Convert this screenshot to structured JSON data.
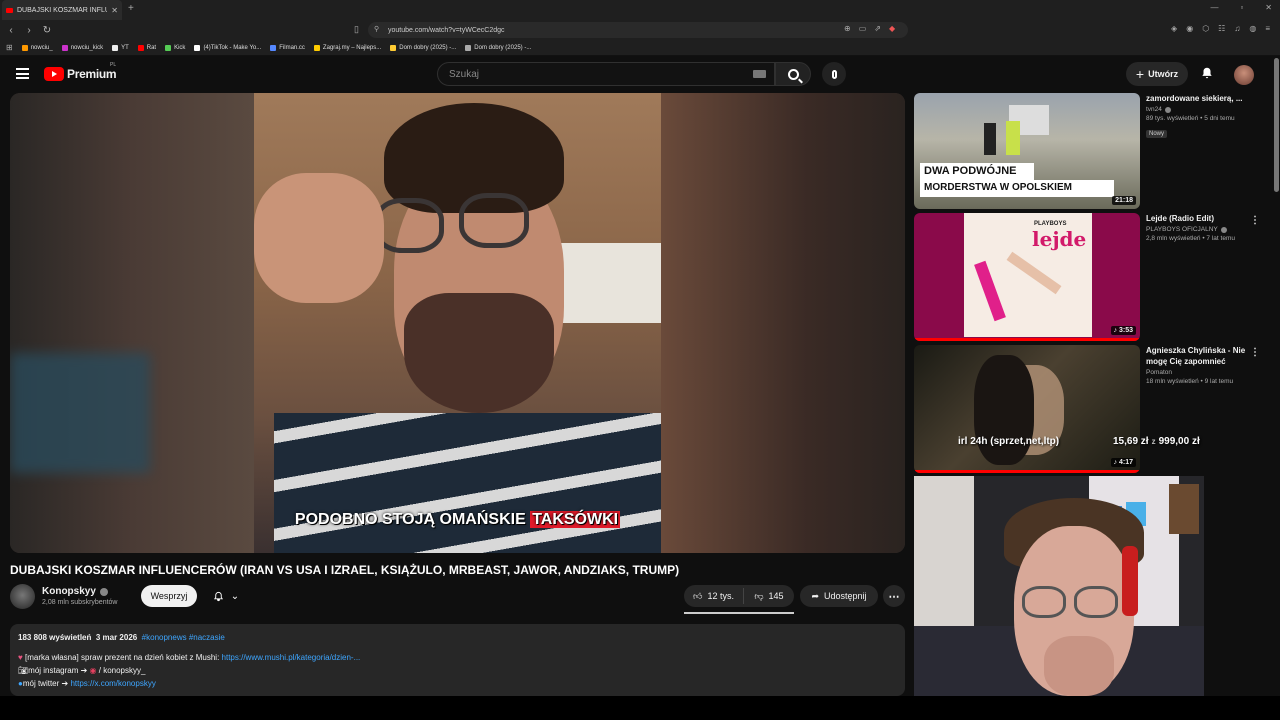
{
  "browser": {
    "tab_title": "DUBAJSKI KOSZMAR INFLUE",
    "url": "youtube.com/watch?v=tyWCecC2dgc",
    "bookmarks": [
      "nowciu_",
      "nowciu_kick",
      "YT",
      "Rat",
      "Kick",
      "(4)TikTok - Make Yo...",
      "Filman.cc",
      "Zagraj.my – Najleps...",
      "Dom dobry (2025) -...",
      "Dom dobry (2025) -..."
    ]
  },
  "header": {
    "logo": "Premium",
    "logo_region": "PL",
    "search_placeholder": "Szukaj",
    "create_label": "Utwórz"
  },
  "video": {
    "subtitle_main": "PODOBNO STOJĄ OMAŃSKIE",
    "subtitle_highlight": "TAKSÓWKI",
    "title": "DUBAJSKI KOSZMAR INFLUENCERÓW (IRAN VS USA I IZRAEL, KSIĄŻULO, MRBEAST, JAWOR, ANDZIAKS, TRUMP)"
  },
  "channel": {
    "name": "Konopskyy",
    "subscribers": "2,08 mln subskrybentów",
    "support_label": "Wesprzyj"
  },
  "actions": {
    "likes": "12 tys.",
    "dislikes": "145",
    "share_label": "Udostępnij",
    "like_ratio": 0.988
  },
  "description": {
    "views": "183 808 wyświetleń",
    "date": "3 mar 2026",
    "tags": "#konopnews #naczasie",
    "line1_text": "[marka własna] spraw prezent na dzień kobiet z Mushi: ",
    "line1_link": "https://www.mushi.pl/kategoria/dzien-...",
    "line2_text": "mój instagram ➔ ",
    "line2_handle": "/ konopskyy_",
    "line3_text": "mój twitter ➔ ",
    "line3_link": "https://x.com/konopskyy"
  },
  "recommendations": [
    {
      "title": "zamordowane siekierą, ...",
      "channel": "tvn24",
      "meta": "89 tys. wyświetleń • 5 dni temu",
      "badge": "Nowy",
      "duration": "21:18",
      "thumb_line1": "DWA PODWÓJNE",
      "thumb_line2": "MORDERSTWA W OPOLSKIEM",
      "progress": 0
    },
    {
      "title": "Lejde (Radio Edit)",
      "channel": "PLAYBOYS OFICJALNY",
      "meta": "2,8 mln wyświetleń • 7 lat temu",
      "duration": "♪ 3:53",
      "thumb_text": "lejde",
      "thumb_brand": "PLAYBOYS",
      "progress": 1
    },
    {
      "title": "Agnieszka Chylińska - Nie mogę Cię zapomnieć",
      "channel": "Pomaton",
      "meta": "18 mln wyświetleń • 9 lat temu",
      "duration": "♪ 4:17",
      "progress": 1
    }
  ],
  "overlay": {
    "left": "irl 24h (sprzet,net,ltp)",
    "amount": "15,69 zł",
    "separator": "z",
    "goal": "999,00 zł"
  }
}
